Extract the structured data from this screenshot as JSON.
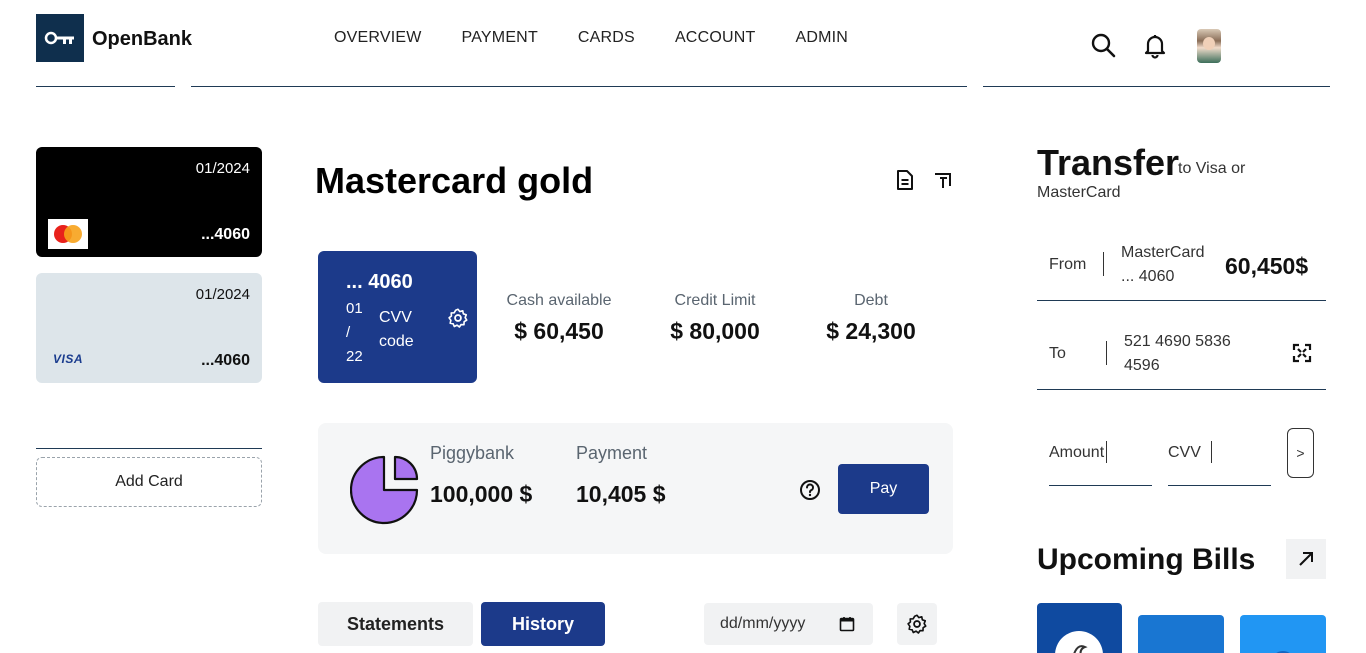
{
  "app": {
    "name": "OpenBank"
  },
  "nav": {
    "items": [
      "OVERVIEW",
      "PAYMENT",
      "CARDS",
      "ACCOUNT",
      "ADMIN"
    ]
  },
  "cards": [
    {
      "expiry": "01/2024",
      "number": "...4060",
      "brand": "MasterCard",
      "color": "#000000"
    },
    {
      "expiry": "01/2024",
      "number": "...4060",
      "brand": "VISA",
      "color": "#dde5ea"
    }
  ],
  "add_card": "Add Card",
  "main": {
    "title": "Mastercard gold",
    "card": {
      "number": "... 4060",
      "expiry": "01 / 22",
      "cvv": "CVV code"
    },
    "stats": [
      {
        "label": "Cash available",
        "value": "$ 60,450"
      },
      {
        "label": "Credit Limit",
        "value": "$ 80,000"
      },
      {
        "label": "Debt",
        "value": "$ 24,300"
      }
    ],
    "piggybank": {
      "label": "Piggybank",
      "value": "100,000 $"
    },
    "payment": {
      "label": "Payment",
      "value": "10,405 $"
    },
    "pay_button": "Pay",
    "tabs": [
      "Statements",
      "History"
    ],
    "active_tab": "History",
    "date_placeholder": "dd/mm/yyyy"
  },
  "transfer": {
    "title": "Transfer",
    "subtitle": "to Visa or MasterCard",
    "from_label": "From",
    "from_card": "MasterCard ... 4060",
    "from_amount": "60,450$",
    "to_label": "To",
    "to_card": "521 4690 5836 4596",
    "amount_label": "Amount",
    "cvv_label": "CVV",
    "send_label": ">"
  },
  "bills": {
    "title": "Upcoming Bills"
  },
  "colors": {
    "primary": "#1c3a8a",
    "logo_bg": "#0f2f4d",
    "panel": "#f5f6f7",
    "pie": "#a974f0"
  }
}
